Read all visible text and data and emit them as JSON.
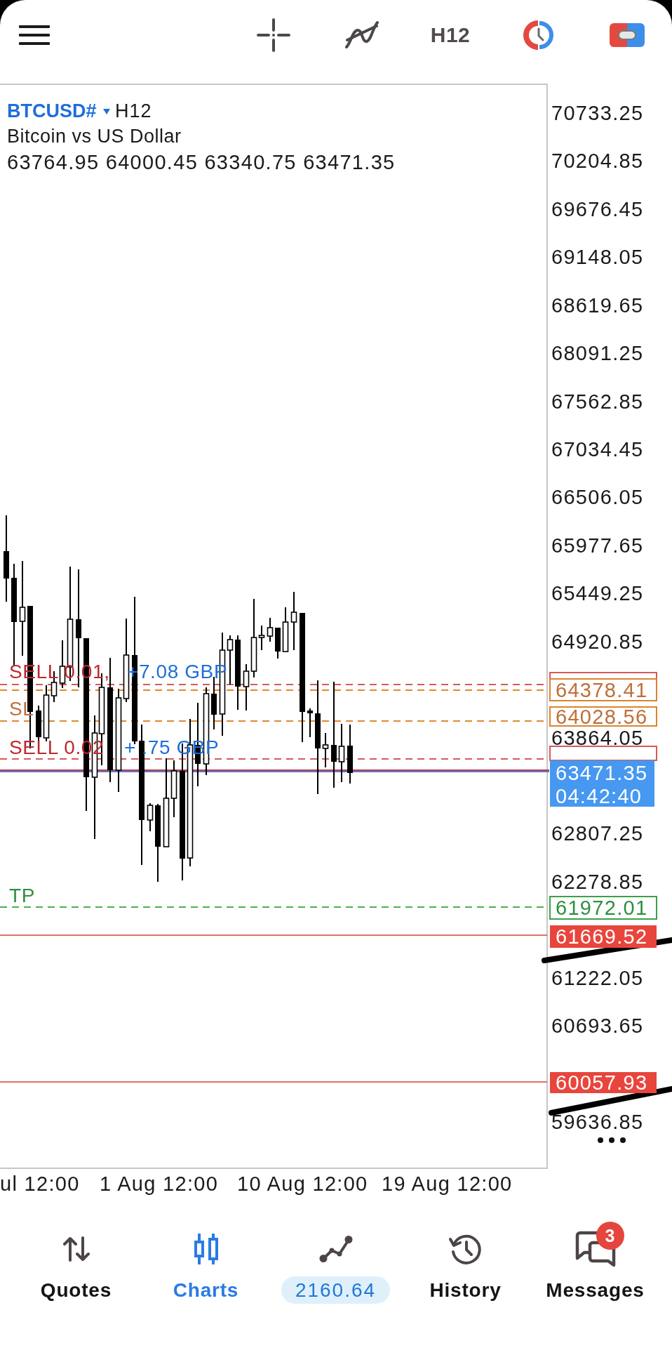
{
  "top_bar": {
    "timeframe": "H12"
  },
  "chart": {
    "symbol": "BTCUSD#",
    "timeframe": "H12",
    "description": "Bitcoin vs US Dollar",
    "ohlc": "63764.95 64000.45 63340.75 63471.35",
    "price_axis": [
      "70733.25",
      "70204.85",
      "69676.45",
      "69148.05",
      "68619.65",
      "68091.25",
      "67562.85",
      "67034.45",
      "66506.05",
      "65977.65",
      "65449.25",
      "64920.85",
      "63864.05",
      "62807.25",
      "62278.85",
      "61222.05",
      "60693.65",
      "59636.85"
    ],
    "levels": [
      {
        "kind": "order",
        "label": "SELL 0.01,",
        "profit": "+7.08 GBP"
      },
      {
        "kind": "stop_loss",
        "price": "64378.41"
      },
      {
        "kind": "stop_loss",
        "label": "SL",
        "price": "64028.56"
      },
      {
        "kind": "order",
        "label": "SELL 0.02",
        "profit": "+ .75 GBP"
      },
      {
        "kind": "market",
        "price": "63471.35",
        "countdown": "04:42:40"
      },
      {
        "kind": "take_profit",
        "label": "TP",
        "price": "61972.01"
      },
      {
        "kind": "level",
        "price": "61669.52"
      },
      {
        "kind": "level",
        "price": "60057.93"
      }
    ],
    "time_axis": [
      "ul 12:00",
      "1 Aug 12:00",
      "10 Aug 12:00",
      "19 Aug 12:00"
    ]
  },
  "nav": [
    {
      "kind": "tab",
      "label": "Quotes",
      "selected": false
    },
    {
      "kind": "tab",
      "label": "Charts",
      "selected": true
    },
    {
      "kind": "value",
      "value": "2160.64",
      "selected": false
    },
    {
      "kind": "tab",
      "label": "History",
      "selected": false
    },
    {
      "kind": "tab",
      "label": "Messages",
      "selected": false,
      "badge": "3"
    }
  ]
}
